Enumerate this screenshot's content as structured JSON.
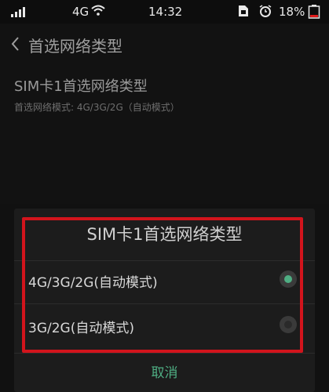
{
  "status_bar": {
    "network": "4G",
    "time": "14:32",
    "battery": "18%"
  },
  "header": {
    "title": "首选网络类型"
  },
  "setting": {
    "title": "SIM卡1首选网络类型",
    "subtitle": "首选网络模式: 4G/3G/2G（自动模式）"
  },
  "dialog": {
    "title": "SIM卡1首选网络类型",
    "options": [
      {
        "label": "4G/3G/2G(自动模式)",
        "selected": true
      },
      {
        "label": "3G/2G(自动模式)",
        "selected": false
      }
    ],
    "cancel_label": "取消"
  },
  "colors": {
    "accent": "#4fae83",
    "highlight_border": "#d2141c",
    "background": "#121212"
  },
  "icons": [
    "signal-icon",
    "wifi-icon",
    "sim-icon",
    "alarm-icon",
    "battery-icon",
    "back-chevron-icon",
    "radio-selected-icon",
    "radio-unselected-icon"
  ]
}
